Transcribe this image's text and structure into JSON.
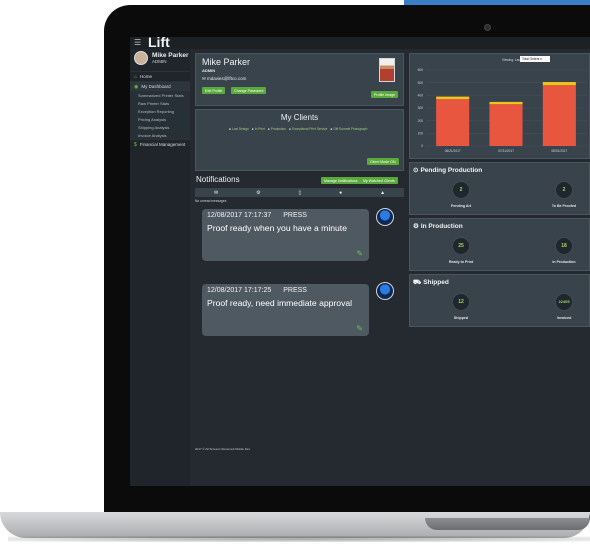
{
  "app": {
    "logo": "Lift"
  },
  "user": {
    "name": "Mike Parker",
    "role": "ADMIN"
  },
  "sidebar": {
    "items": [
      {
        "label": "Home",
        "icon": "home-icon"
      },
      {
        "label": "My Dashboard",
        "icon": "dashboard-icon"
      }
    ],
    "subitems": [
      "Summarized Printer Stats",
      "Raw Printer Stats",
      "Exception Reporting",
      "Pricing Analysis",
      "Shipping Analysis",
      "Invoice Analysis"
    ],
    "financial": "Financial Management"
  },
  "profile": {
    "name": "Mike Parker",
    "role": "ADMIN",
    "email": "mdavies@lftco.com",
    "edit_label": "Edit Profile",
    "password_label": "Change Password",
    "photo_label": "Profile Image"
  },
  "clients": {
    "title": "My Clients",
    "legend": [
      "Lost Design",
      "In Print",
      "Production",
      "Exceptional Print Service",
      "Gift Summit Photograph"
    ],
    "dashboard_label": "Client Mode ON"
  },
  "notifications": {
    "title": "Notifications",
    "manage_label": "Manage Notifications",
    "watched_label": "My Watched Clients",
    "tabs": [
      "✉",
      "⚙",
      "▯",
      "●",
      "▲"
    ],
    "no_unread": "No unread messages",
    "messages": [
      {
        "timestamp": "12/08/2017 17:17:37",
        "tag": "PRESS",
        "text": "Proof ready when you have a minute"
      },
      {
        "timestamp": "12/08/2017 17:17:25",
        "tag": "PRESS",
        "text": "Proof ready, need immediate approval"
      }
    ]
  },
  "chart": {
    "viewing_label": "Viewing: Last 6 Months",
    "select_value": "Total Orders"
  },
  "chart_data": {
    "type": "bar",
    "categories": [
      "06/21/2017",
      "07/31/2017",
      "08/31/2017"
    ],
    "series": [
      {
        "name": "Orders",
        "values": [
          370,
          330,
          480
        ]
      },
      {
        "name": "Rush",
        "values": [
          20,
          18,
          25
        ]
      }
    ],
    "ylim": [
      0,
      600
    ],
    "yticks": [
      "0",
      "100",
      "200",
      "300",
      "400",
      "500",
      "600"
    ],
    "colors": [
      "#e8563f",
      "#f0c419"
    ],
    "grid": true
  },
  "panels": {
    "pending": {
      "title": "Pending Production",
      "left_value": "2",
      "left_label": "Pending Art",
      "right_value": "2",
      "right_label": "To Be Proofed"
    },
    "in_production": {
      "title": "In Production",
      "left_value": "25",
      "left_label": "Ready to Print",
      "right_value": "18",
      "right_label": "In Production"
    },
    "shipped": {
      "title": "Shipped",
      "left_value": "12",
      "left_label": "Shipped",
      "right_value": "22405",
      "right_label": "Invoiced"
    }
  },
  "footer": "2017 © All Screens Reserved Mobile Dev"
}
